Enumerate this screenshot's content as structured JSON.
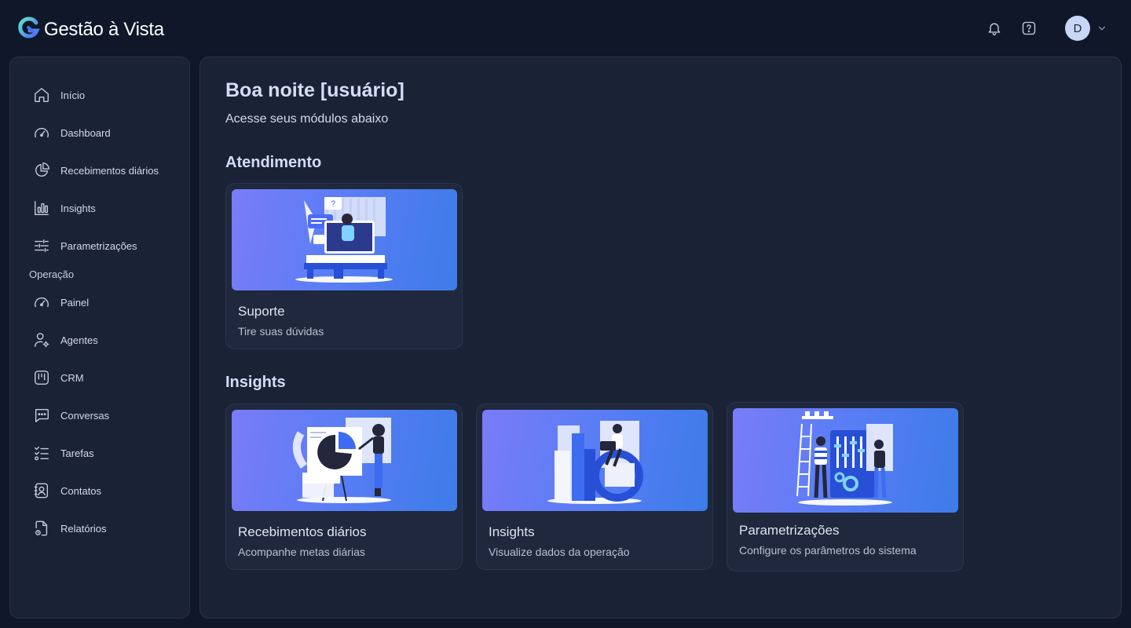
{
  "app": {
    "name": "Gestão à Vista"
  },
  "header": {
    "avatar_initial": "D"
  },
  "sidebar": {
    "items": [
      {
        "label": "Início",
        "icon": "home-icon"
      },
      {
        "label": "Dashboard",
        "icon": "gauge-icon"
      },
      {
        "label": "Recebimentos diários",
        "icon": "pie-chart-icon"
      },
      {
        "label": "Insights",
        "icon": "bar-chart-icon"
      },
      {
        "label": "Parametrizações",
        "icon": "sliders-icon"
      }
    ],
    "section_label": "Operação",
    "section_items": [
      {
        "label": "Painel",
        "icon": "gauge-icon"
      },
      {
        "label": "Agentes",
        "icon": "user-gear-icon"
      },
      {
        "label": "CRM",
        "icon": "kanban-icon"
      },
      {
        "label": "Conversas",
        "icon": "chat-icon"
      },
      {
        "label": "Tarefas",
        "icon": "checklist-icon"
      },
      {
        "label": "Contatos",
        "icon": "contacts-icon"
      },
      {
        "label": "Relatórios",
        "icon": "report-icon"
      }
    ]
  },
  "main": {
    "greeting": "Boa noite [usuário]",
    "subtitle": "Acesse seus módulos abaixo",
    "sections": [
      {
        "title": "Atendimento",
        "cards": [
          {
            "title": "Suporte",
            "description": "Tire suas dúvidas",
            "illustration": "support-illustration"
          }
        ]
      },
      {
        "title": "Insights",
        "cards": [
          {
            "title": "Recebimentos diários",
            "description": "Acompanhe metas diárias",
            "illustration": "pie-chart-presentation-illustration"
          },
          {
            "title": "Insights",
            "description": "Visualize dados da operação",
            "illustration": "data-analysis-illustration"
          },
          {
            "title": "Parametrizações",
            "description": "Configure os parâmetros do sistema",
            "illustration": "configuration-illustration"
          }
        ]
      }
    ]
  },
  "colors": {
    "background": "#0f1729",
    "panel": "#1a2236",
    "card": "#1f283c",
    "accent_gradient_start": "#7a7cf7",
    "accent_gradient_end": "#3d7ce9",
    "avatar": "#c9d6f5"
  }
}
